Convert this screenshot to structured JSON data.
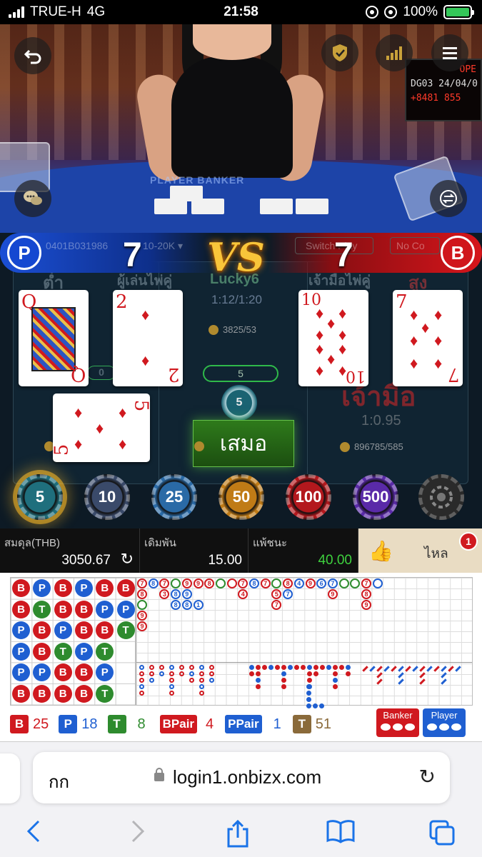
{
  "status_bar": {
    "carrier": "TRUE-H",
    "network": "4G",
    "time": "21:58",
    "battery": "100%",
    "battery_level_percent": 100
  },
  "video": {
    "table_label": "PLAYER   BANKER",
    "display_lines": [
      "OPE",
      "DG03 24/04/0",
      "+8481 855"
    ]
  },
  "game": {
    "player_badge": "P",
    "banker_badge": "B",
    "table_id": "0401B031986",
    "limit": "10-20K",
    "player_score": "7",
    "vs_label": "VS",
    "banker_score": "7",
    "switch_label": "Switch Play",
    "no_comm_label": "No Co",
    "player_pair_label": "ผู้เล่นไพ่คู่",
    "banker_pair_label": "เจ้ามือไพ่คู่",
    "low_label": "ต่ำ",
    "high_label": "สูง",
    "lucky_label": "Lucky6",
    "lucky_odds": "1:12/1:20",
    "lucky_stats": "3825/53",
    "tie_count": "5",
    "tie_chip": "5",
    "tie_label": "เสมอ",
    "banker_label": "เจ้ามือ",
    "banker_odds": "1:0.95",
    "banker_stats": "896785/585",
    "player_count": "0",
    "player_cards": [
      {
        "rank": "Q",
        "suit": "♦",
        "face": true
      },
      {
        "rank": "2",
        "suit": "♦",
        "face": false
      },
      {
        "rank": "5",
        "suit": "♦",
        "face": false
      }
    ],
    "banker_cards": [
      {
        "rank": "10",
        "suit": "♦",
        "face": false
      },
      {
        "rank": "7",
        "suit": "♦",
        "face": false
      }
    ]
  },
  "chips": [
    {
      "label": "5",
      "color": "#1f6f7d",
      "selected": true
    },
    {
      "label": "10",
      "color": "#3a4a6a",
      "selected": false
    },
    {
      "label": "25",
      "color": "#2a6aa6",
      "selected": false
    },
    {
      "label": "50",
      "color": "#c07b16",
      "selected": false
    },
    {
      "label": "100",
      "color": "#b3181d",
      "selected": false
    },
    {
      "label": "500",
      "color": "#5a2aa8",
      "selected": false
    }
  ],
  "info": {
    "balance_label": "สมดุล(THB)",
    "balance_value": "3050.67",
    "bet_label": "เดิมพัน",
    "bet_value": "15.00",
    "winloss_label": "แพ้ชนะ",
    "winloss_value": "40.00",
    "like_label": "ไหล",
    "like_badge": "1"
  },
  "roadmap": {
    "bead_plate": [
      [
        "B",
        "P",
        "B",
        "P",
        "B",
        "B"
      ],
      [
        "B",
        "T",
        "B",
        "B",
        "P",
        "P"
      ],
      [
        "P",
        "B",
        "P",
        "B",
        "B",
        "T"
      ],
      [
        "P",
        "B",
        "T",
        "P",
        "T",
        ""
      ],
      [
        "P",
        "P",
        "B",
        "B",
        "P",
        ""
      ],
      [
        "B",
        "B",
        "B",
        "B",
        "T",
        ""
      ]
    ],
    "summary": {
      "banker_letter": "B",
      "banker_count": "25",
      "player_letter": "P",
      "player_count": "18",
      "tie_letter": "T",
      "tie_count": "8",
      "bpair_label": "BPair",
      "bpair_count": "4",
      "ppair_label": "PPair",
      "ppair_count": "1",
      "total_letter": "T",
      "total_count": "51"
    },
    "predict_banker": "Banker",
    "predict_player": "Player",
    "colors": {
      "banker": "#d0191f",
      "player": "#1f5fd1",
      "tie": "#2e8b2e",
      "total": "#8a6a3a"
    }
  },
  "browser": {
    "aa_label": "กก",
    "url": "login1.onbizx.com"
  }
}
